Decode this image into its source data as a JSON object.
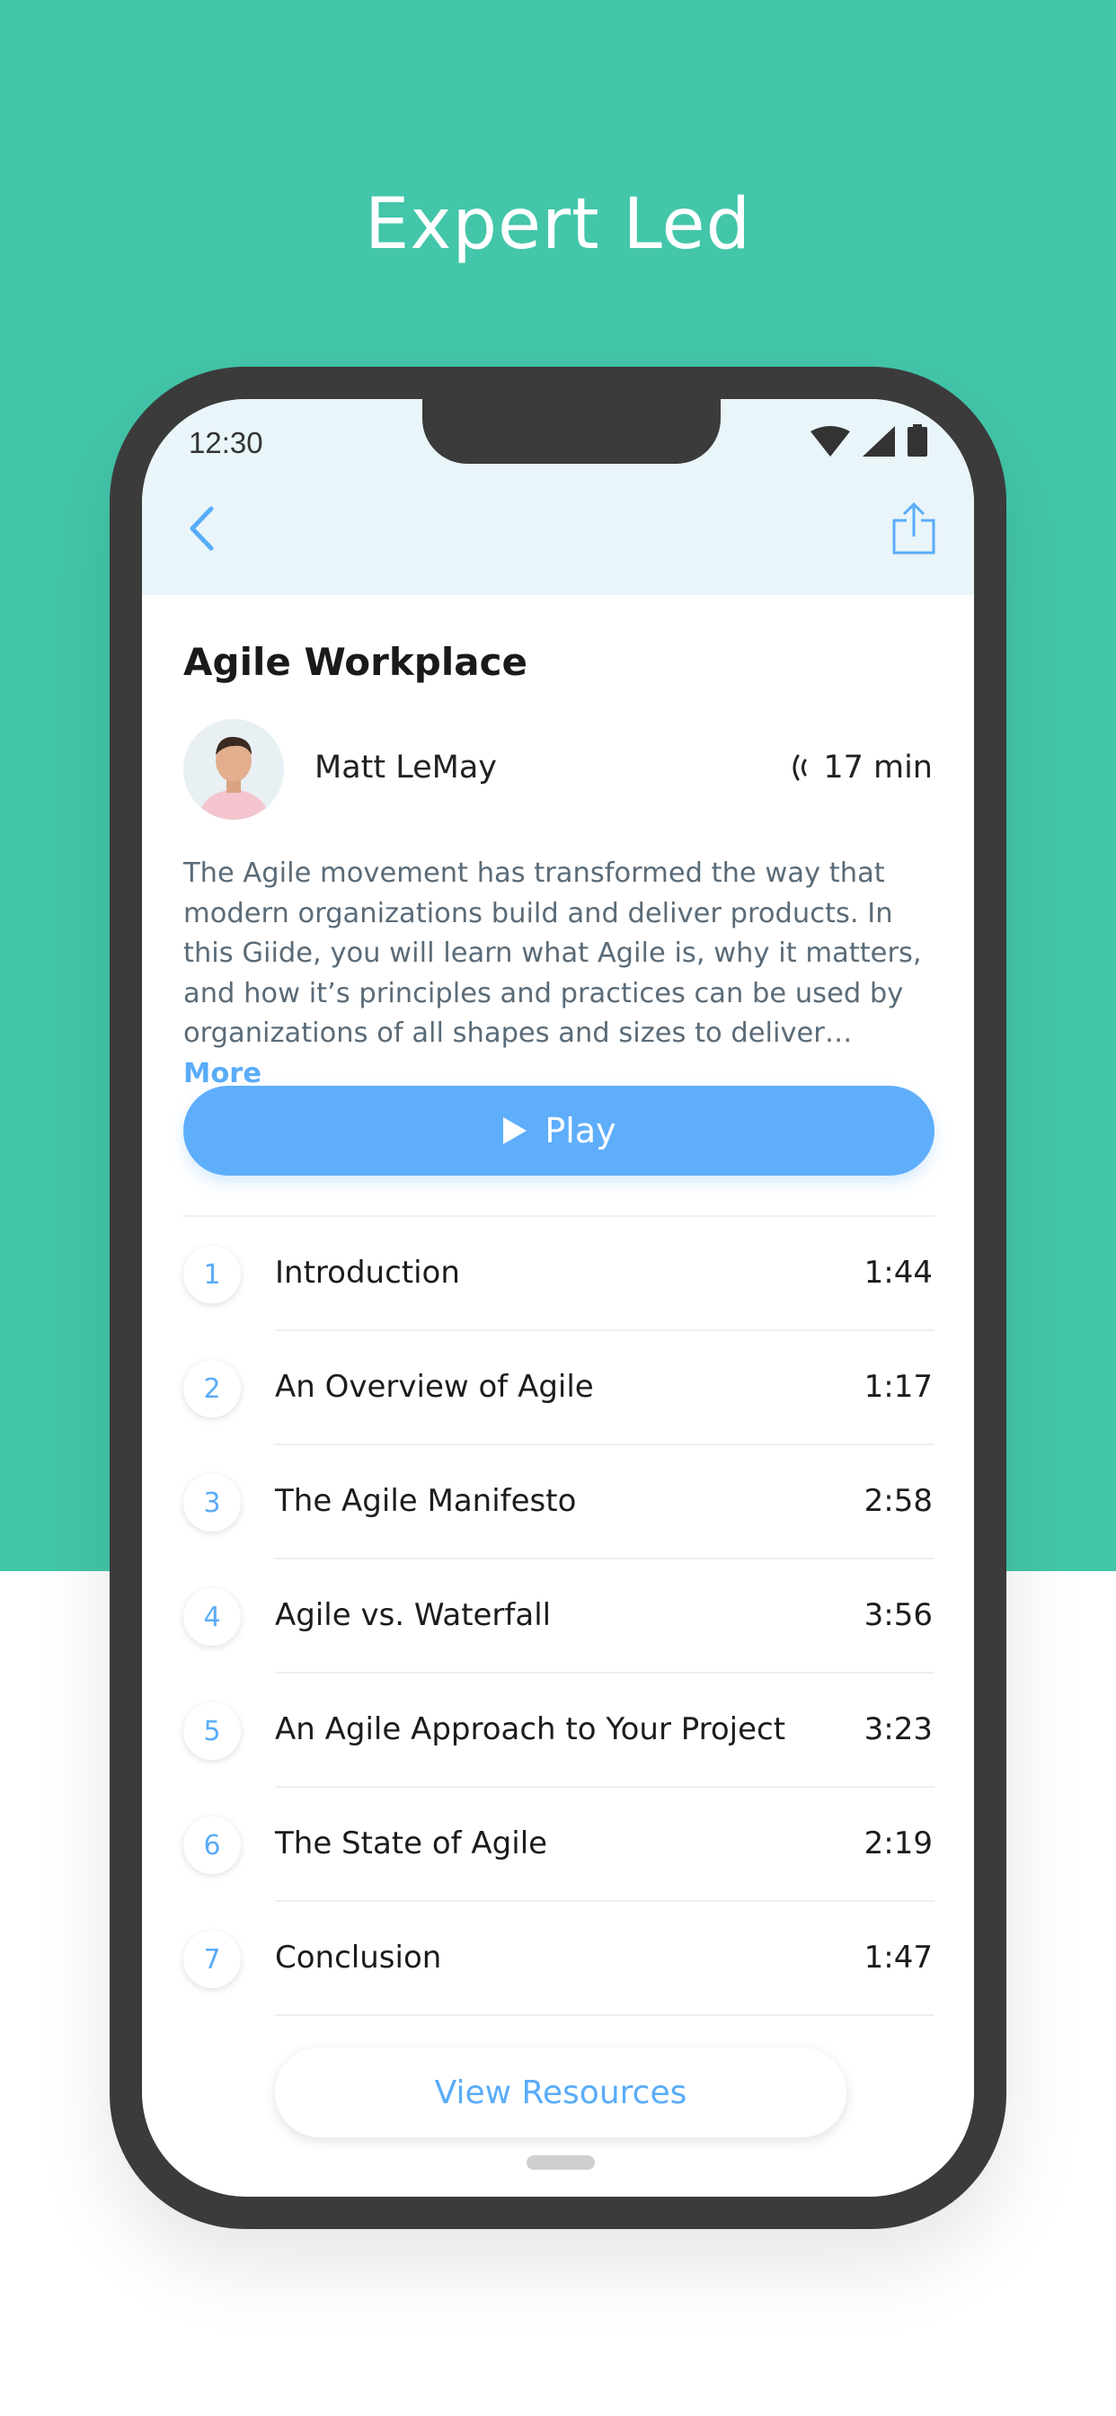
{
  "headline": "Expert Led",
  "status_bar": {
    "time": "12:30",
    "icons": [
      "wifi-icon",
      "signal-icon",
      "battery-icon"
    ]
  },
  "nav": {
    "back_icon": "chevron-left-icon",
    "share_icon": "share-icon"
  },
  "course": {
    "title": "Agile Workplace",
    "author": "Matt LeMay",
    "duration": "17 min",
    "description": "The Agile movement has transformed the way that modern organizations build and deliver products. In this Giide, you will learn what Agile is, why it matters, and how it’s principles and practices can be used by organizations of all shapes and sizes to deliver…",
    "more_label": "More",
    "play_label": "Play"
  },
  "chapters": [
    {
      "num": "1",
      "title": "Introduction",
      "time": "1:44"
    },
    {
      "num": "2",
      "title": "An Overview of Agile",
      "time": "1:17"
    },
    {
      "num": "3",
      "title": "The Agile Manifesto",
      "time": "2:58"
    },
    {
      "num": "4",
      "title": "Agile vs. Waterfall",
      "time": "3:56"
    },
    {
      "num": "5",
      "title": "An Agile Approach to Your Project",
      "time": "3:23"
    },
    {
      "num": "6",
      "title": "The State of Agile",
      "time": "2:19"
    },
    {
      "num": "7",
      "title": "Conclusion",
      "time": "1:47"
    }
  ],
  "resources_label": "View Resources",
  "colors": {
    "brand_green": "#43C6AA",
    "accent_blue": "#5EAEFC",
    "header_bg": "#E9F5F9"
  }
}
